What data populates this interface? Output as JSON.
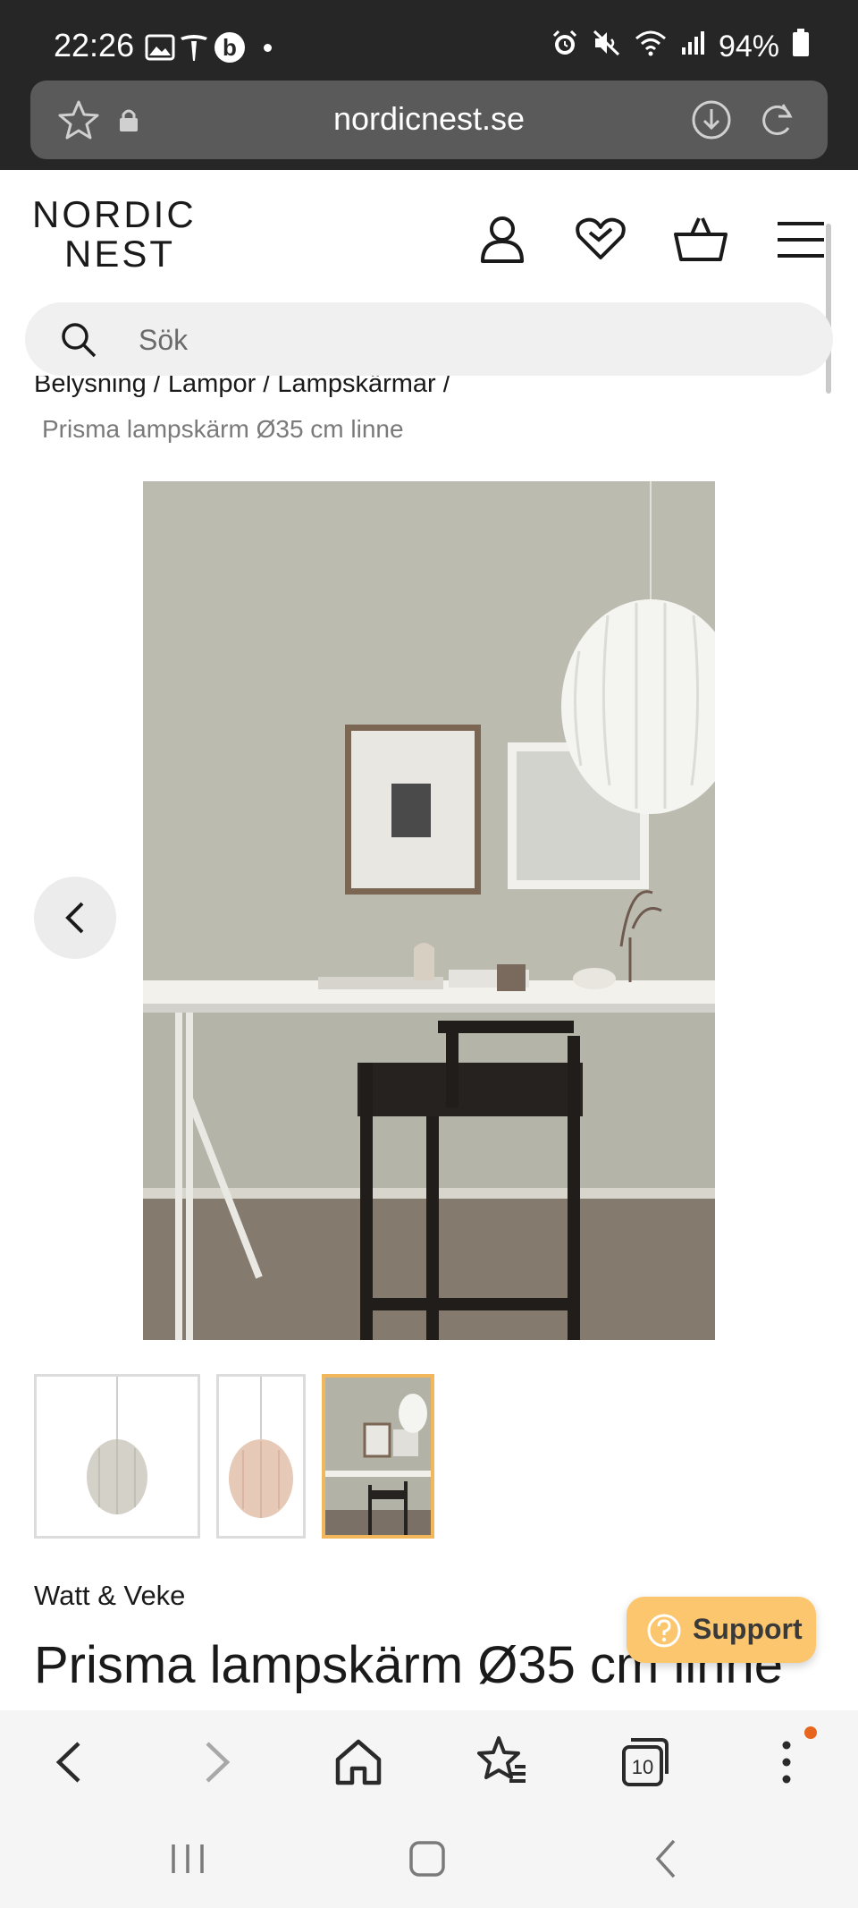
{
  "status_bar": {
    "time": "22:26",
    "battery": "94%",
    "icons": [
      "image-icon",
      "tesla-icon",
      "b-app-icon",
      "dot-icon",
      "alarm-icon",
      "mute-icon",
      "wifi-icon",
      "signal-icon",
      "battery-icon"
    ]
  },
  "browser": {
    "url": "nordicnest.se"
  },
  "header": {
    "logo_line1": "NORDIC",
    "logo_line2": "NEST",
    "search_placeholder": "Sök"
  },
  "breadcrumb": {
    "path": "Belysning / Lampor / Lampskärmar /",
    "current": "Prisma lampskärm Ø35 cm linne"
  },
  "product": {
    "brand": "Watt & Veke",
    "title": "Prisma lampskärm Ø35 cm linne",
    "thumbnails": [
      "thumbnail-1",
      "thumbnail-2",
      "thumbnail-3"
    ],
    "selected_thumbnail": 3
  },
  "support": {
    "label": "Support"
  },
  "colors": {
    "status_bar_bg": "#262626",
    "url_bar_bg": "#5a5a5a",
    "support_bg": "#fcc66e",
    "selected_thumb_border": "#f2b75a",
    "notification_dot": "#e8651e"
  }
}
